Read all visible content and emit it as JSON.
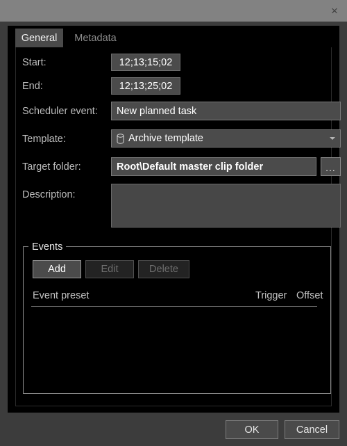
{
  "titlebar": {
    "close_label": "×",
    "close_icon": "close-icon",
    "background": "#828282"
  },
  "tabs": [
    {
      "label": "General",
      "selected": true
    },
    {
      "label": "Metadata",
      "selected": false
    }
  ],
  "form": {
    "start": {
      "label": "Start:",
      "value": "12;13;15;02"
    },
    "end": {
      "label": "End:",
      "value": "12;13;25;02"
    },
    "scheduler_event": {
      "label": "Scheduler event:",
      "value": "New planned task"
    },
    "template": {
      "label": "Template:",
      "value": "Archive template",
      "icon": "database-cylinder-icon",
      "caret_icon": "chevron-down-icon"
    },
    "target_folder": {
      "label": "Target folder:",
      "value": "Root\\Default master clip folder",
      "browse_label": "..."
    },
    "description": {
      "label": "Description:",
      "value": "",
      "placeholder": ""
    }
  },
  "events": {
    "title": "Events",
    "buttons": [
      {
        "label": "Add",
        "enabled": true
      },
      {
        "label": "Edit",
        "enabled": false
      },
      {
        "label": "Delete",
        "enabled": false
      }
    ],
    "columns": [
      {
        "label": "Event preset"
      },
      {
        "label": "Trigger"
      },
      {
        "label": "Offset"
      }
    ],
    "rows": []
  },
  "footer": {
    "ok_label": "OK",
    "cancel_label": "Cancel"
  },
  "colors": {
    "window_frame": "#3c3c3c",
    "titlebar": "#828282",
    "content_bg": "#000000",
    "field_bg": "#4b4b4b",
    "tab_selected_bg": "#4a4a4a",
    "text_primary": "#ffffff",
    "text_label": "#bdbdbd",
    "text_disabled": "#6e6e6e"
  }
}
